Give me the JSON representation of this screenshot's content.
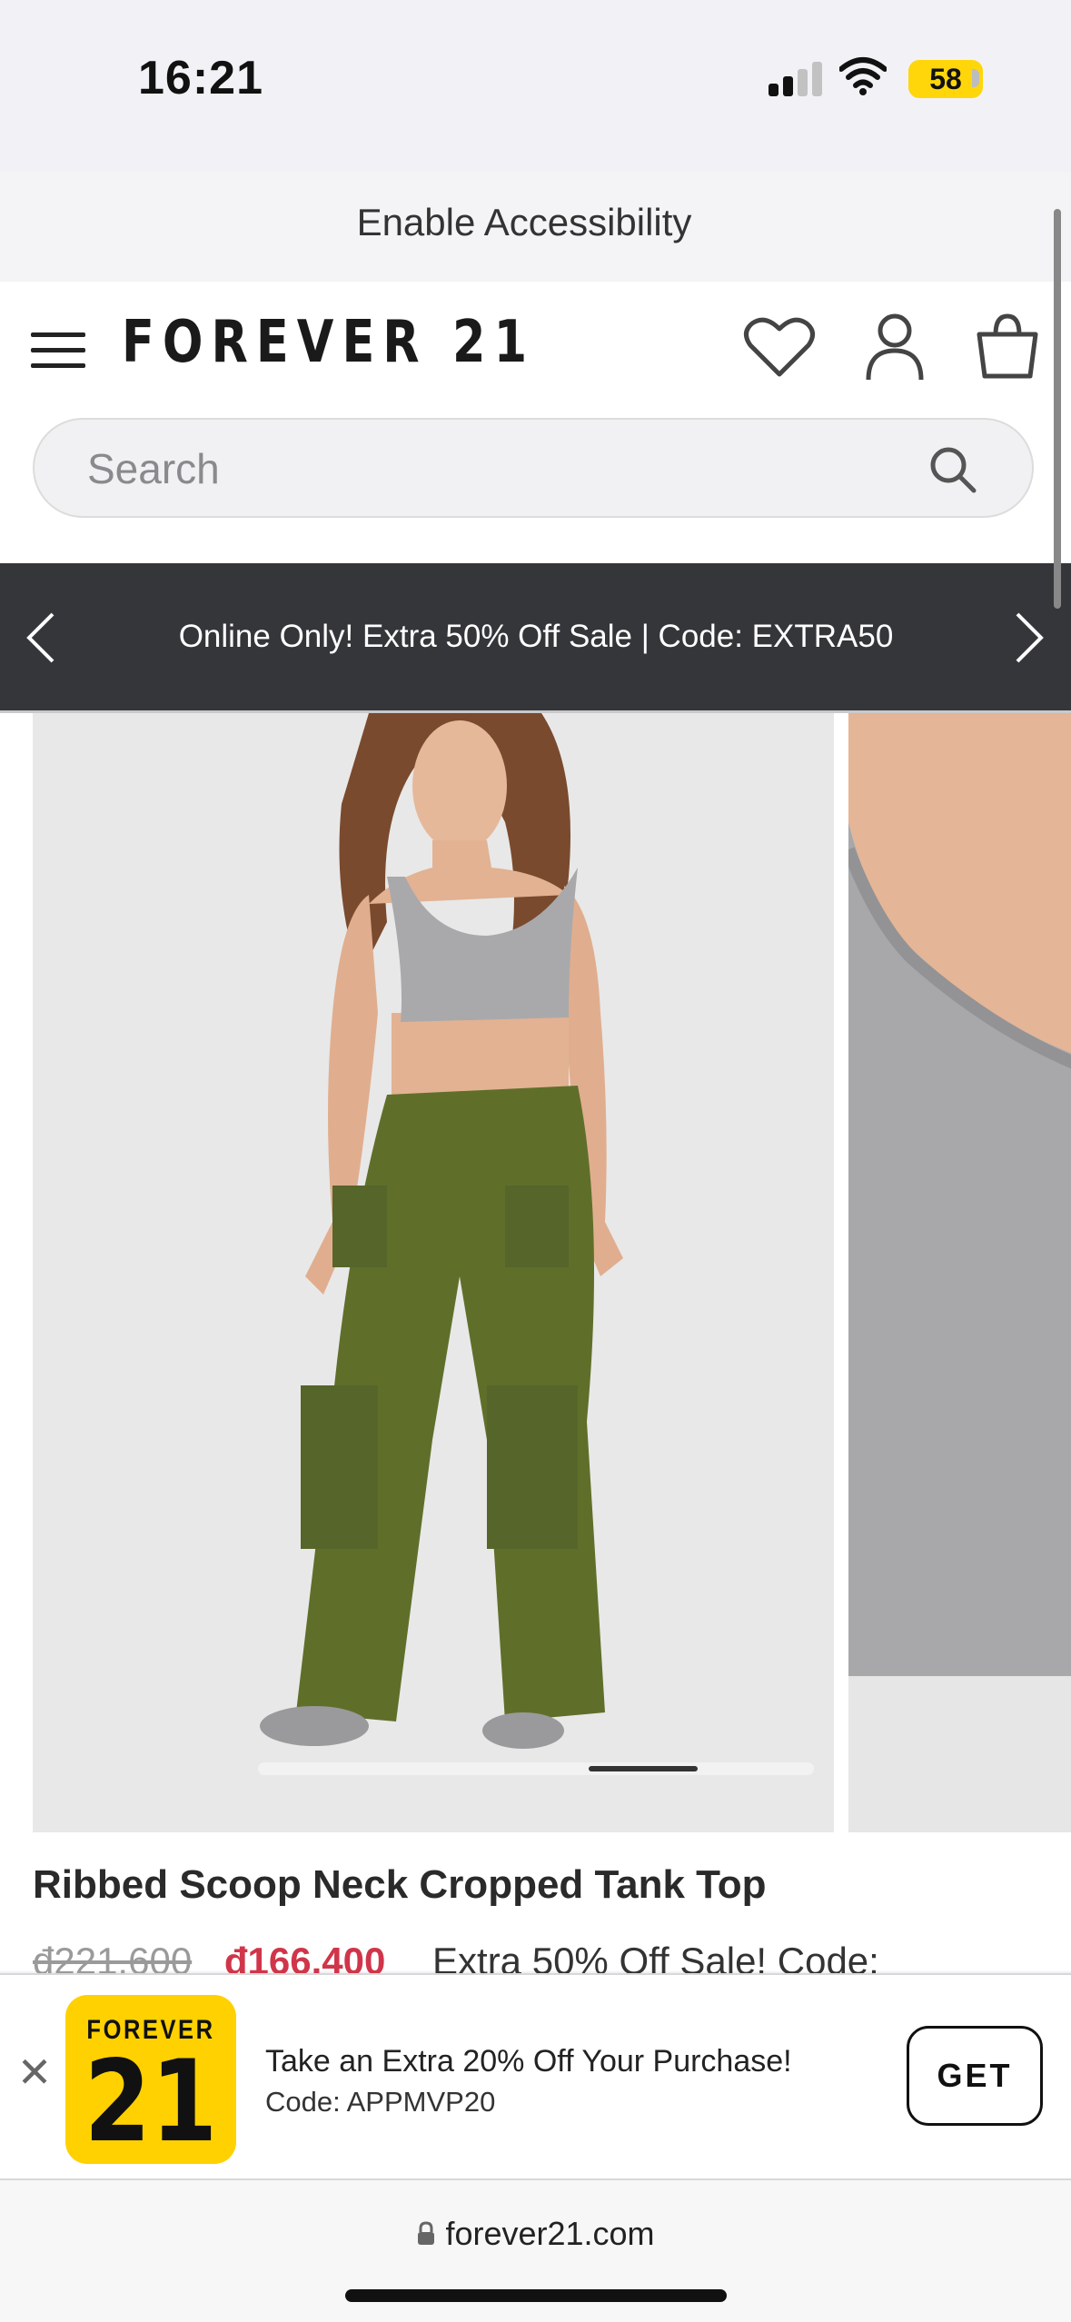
{
  "status_bar": {
    "time": "16:21",
    "battery": "58"
  },
  "accessibility": {
    "label": "Enable Accessibility"
  },
  "header": {
    "logo": "FOREVER 21",
    "search": {
      "placeholder": "Search",
      "value": ""
    }
  },
  "promo": {
    "text": "Online Only! Extra 50% Off Sale | Code: EXTRA50"
  },
  "product": {
    "title": "Ribbed Scoop Neck Cropped Tank Top",
    "price_original": "đ221.600",
    "price_sale": "đ166.400",
    "sale_note": "Extra 50% Off Sale! Code:"
  },
  "app_banner": {
    "icon_top": "FOREVER",
    "icon_num": "21",
    "line1": "Take an Extra 20% Off Your Purchase!",
    "line2": "Code: APPMVP20",
    "button": "GET"
  },
  "browser": {
    "url": "forever21.com"
  },
  "colors": {
    "promo_bg": "#343639",
    "sale_price": "#d0354a",
    "app_icon": "#ffd100"
  }
}
